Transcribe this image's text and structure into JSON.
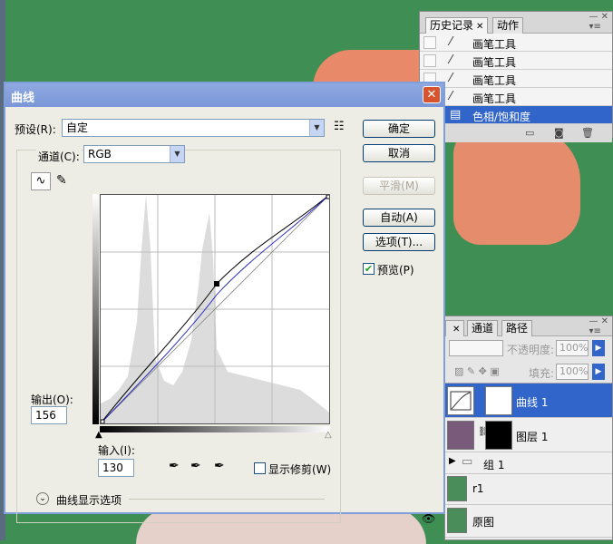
{
  "history": {
    "tabs": [
      "历史记录",
      "动作"
    ],
    "items": [
      {
        "label": "画笔工具",
        "selected": false
      },
      {
        "label": "画笔工具",
        "selected": false
      },
      {
        "label": "画笔工具",
        "selected": false
      },
      {
        "label": "画笔工具",
        "selected": false
      },
      {
        "label": "色相/饱和度",
        "selected": true
      }
    ]
  },
  "layers": {
    "tabs": [
      "通道",
      "路径"
    ],
    "opacity_label": "不透明度:",
    "opacity_value": "100%",
    "fill_label": "填充:",
    "fill_value": "100%",
    "items": [
      {
        "name": "曲线 1",
        "selected": true
      },
      {
        "name": "图层 1",
        "selected": false
      },
      {
        "name": "组 1",
        "selected": false
      },
      {
        "name": "r1",
        "selected": false
      },
      {
        "name": "原图",
        "selected": false
      }
    ]
  },
  "dialog": {
    "title": "曲线",
    "preset_label": "预设(R):",
    "preset_value": "自定",
    "channel_label": "通道(C):",
    "channel_value": "RGB",
    "output_label": "输出(O):",
    "output_value": "156",
    "input_label": "输入(I):",
    "input_value": "130",
    "show_clipping_label": "显示修剪(W)",
    "curve_options_label": "曲线显示选项",
    "buttons": {
      "ok": "确定",
      "cancel": "取消",
      "smooth": "平滑(M)",
      "auto": "自动(A)",
      "options": "选项(T)..."
    },
    "preview_label": "预览(P)",
    "preview_checked": true,
    "show_clipping_checked": false
  },
  "colors": {
    "canvas_green": "#3f8f55",
    "selection_blue": "#3265c9",
    "titlebar_blue": "#7b97d8"
  }
}
